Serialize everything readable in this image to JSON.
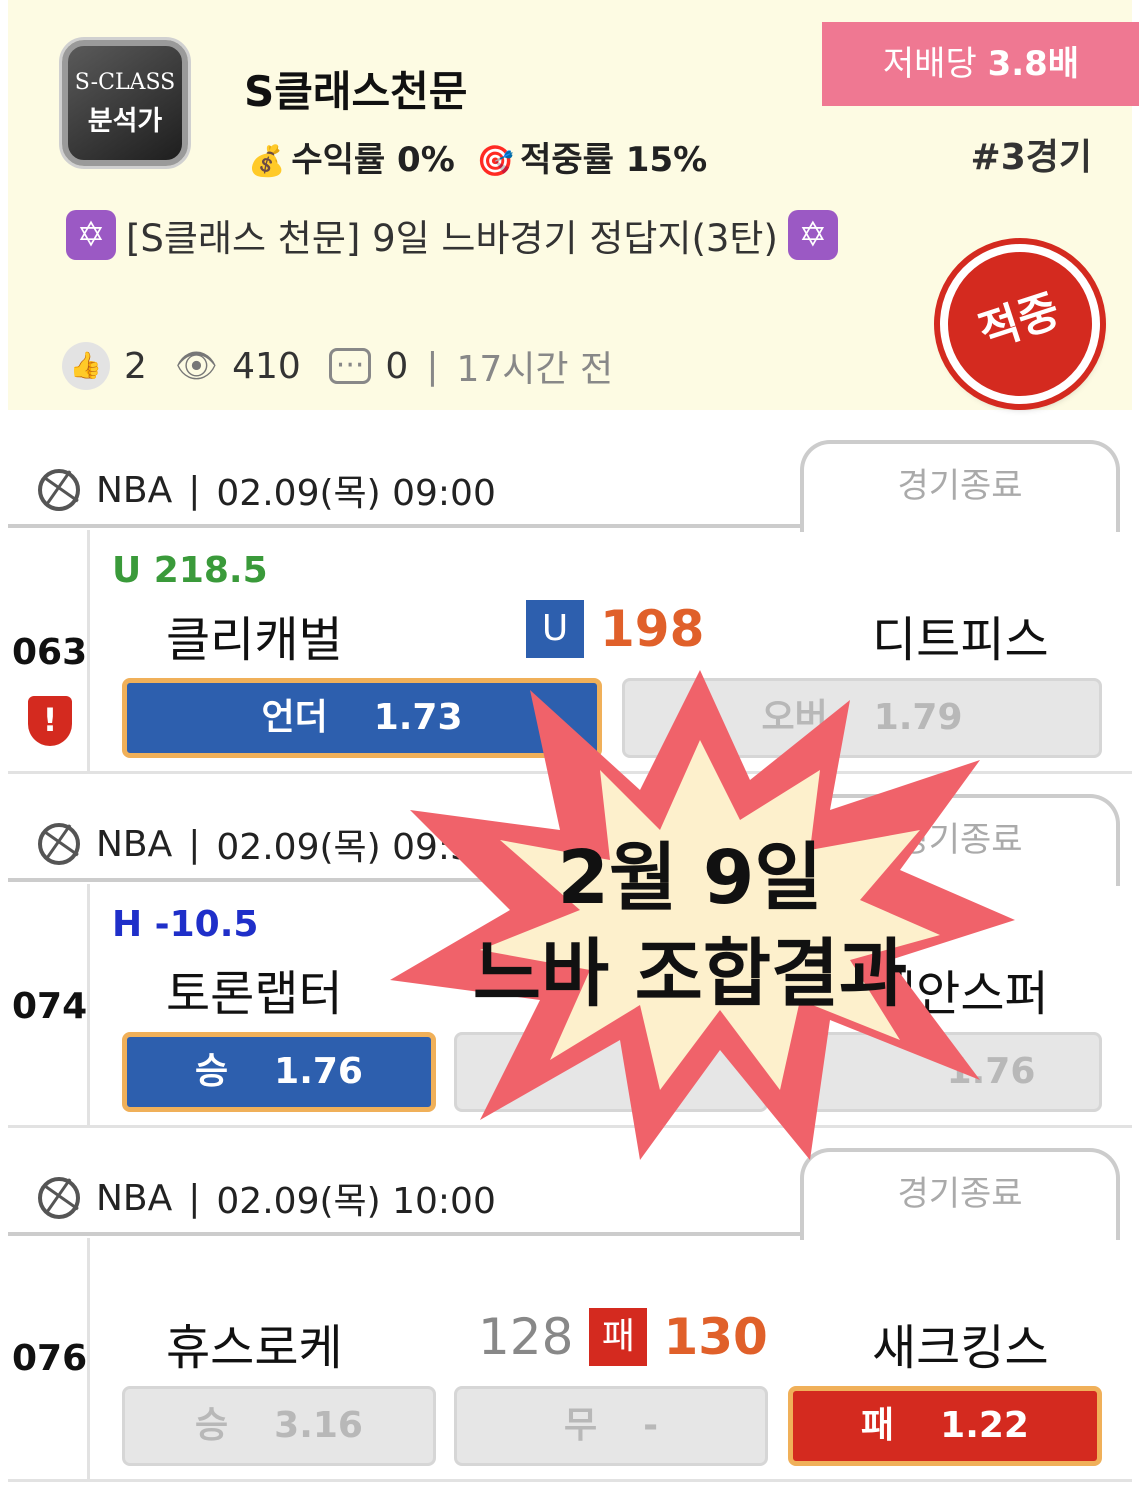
{
  "header": {
    "avatar_line1": "S-CLASS",
    "avatar_line2": "분석가",
    "name": "S클래스천문",
    "profit_icon": "💰",
    "profit_label": "수익률 0%",
    "hit_icon": "🎯",
    "hit_label": "적중률 15%",
    "odds_prefix": "저배당 ",
    "odds_value": "3.8배",
    "games": "#3경기",
    "title": "[S클래스 천문] 9일 느바경기 정답지(3탄)",
    "likes": "2",
    "views": "410",
    "comments": "0",
    "time": "17시간 전",
    "stamp": "적중"
  },
  "games": [
    {
      "league": "NBA",
      "datetime": "02.09(목) 09:00",
      "status": "경기종료",
      "number": "063",
      "line": "U 218.5",
      "home": "클리캐벌",
      "away": "디트피스",
      "badge": "U",
      "score": "198",
      "btn1_label": "언더",
      "btn1_odds": "1.73",
      "btn2_label": "오버",
      "btn2_odds": "1.79"
    },
    {
      "league": "NBA",
      "datetime": "02.09(목) 09:30",
      "status": "경기종료",
      "number": "074",
      "line": "H -10.5",
      "home": "토론랩터",
      "away": "샌안스퍼",
      "btn1_label": "승",
      "btn1_odds": "1.76",
      "btn3_odds": "1.76"
    },
    {
      "league": "NBA",
      "datetime": "02.09(목) 10:00",
      "status": "경기종료",
      "number": "076",
      "home": "휴스로케",
      "away": "새크킹스",
      "home_score": "128",
      "badge": "패",
      "away_score": "130",
      "btn1_label": "승",
      "btn1_odds": "3.16",
      "btn2_label": "무",
      "btn2_odds": "-",
      "btn3_label": "패",
      "btn3_odds": "1.22"
    }
  ],
  "overlay": {
    "line1": "2월 9일",
    "line2": "느바 조합결과"
  },
  "colors": {
    "header_bg": "#fdfbe3",
    "pink": "#ef7892",
    "blue": "#2d5fae",
    "red": "#d42a1f",
    "orange_score": "#e0602a",
    "green_line": "#3a9a3a",
    "blue_line": "#1f2fc9"
  }
}
